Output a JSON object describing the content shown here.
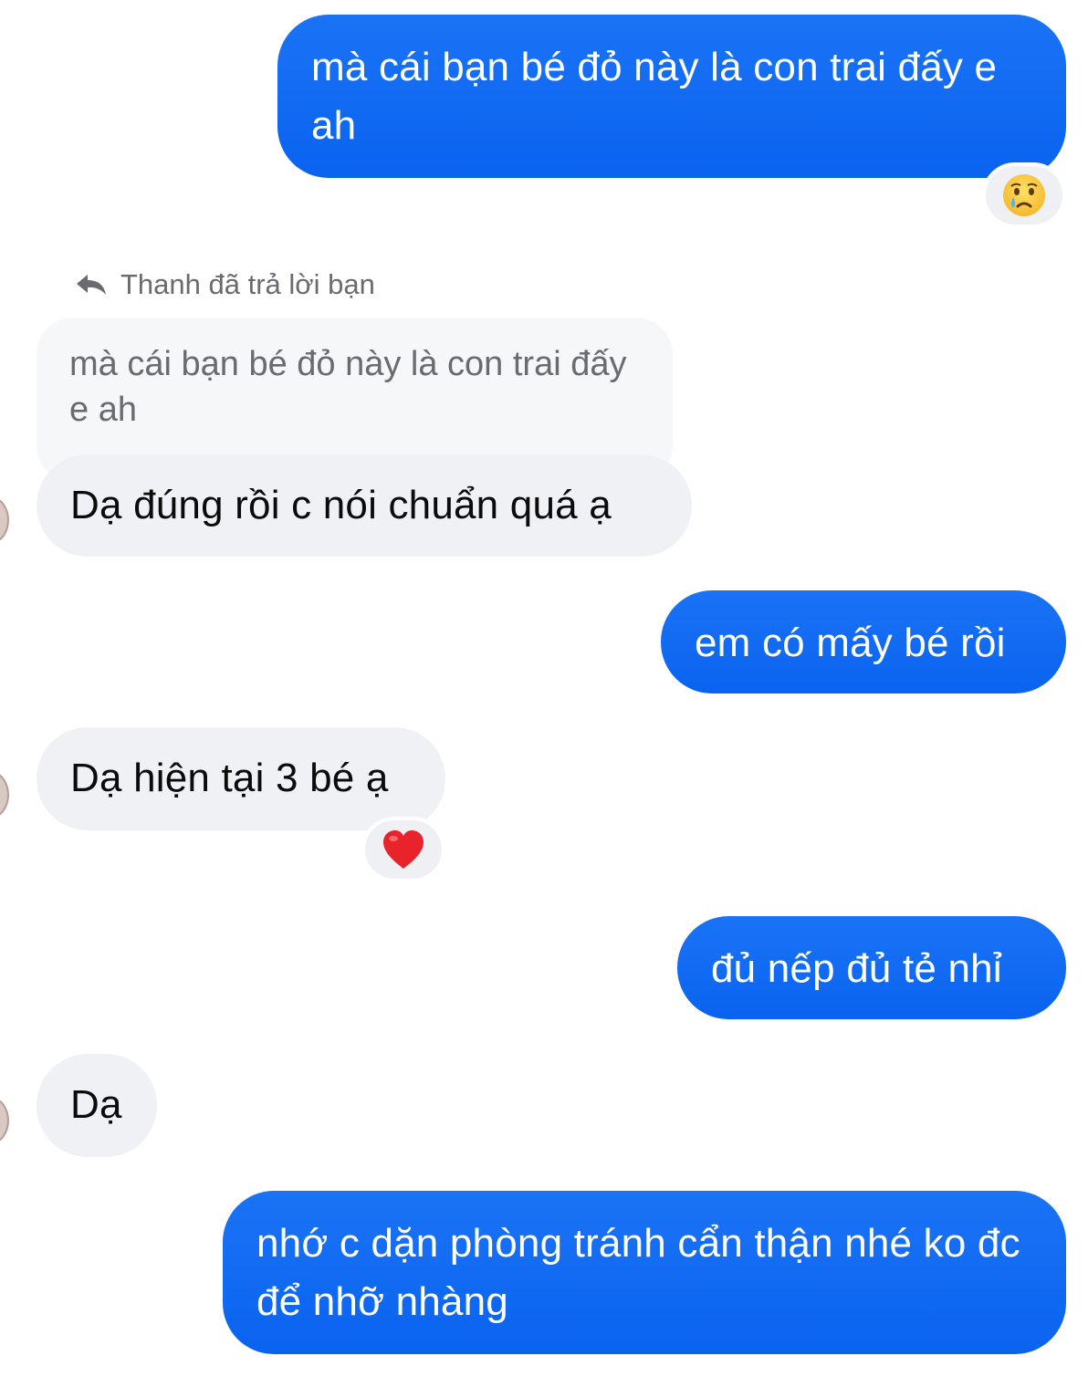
{
  "conversation": {
    "messages": [
      {
        "id": "m1",
        "direction": "outgoing",
        "text": "mà cái bạn bé đỏ này là con trai đấy e ah",
        "reaction": "crying-face"
      },
      {
        "id": "m2",
        "direction": "incoming",
        "reply_label": "Thanh đã trả lời bạn",
        "quoted_text": "mà cái bạn bé đỏ này là con trai đấy e ah",
        "text": "Dạ đúng rồi c nói chuẩn quá ạ"
      },
      {
        "id": "m3",
        "direction": "outgoing",
        "text": "em có mấy bé rồi"
      },
      {
        "id": "m4",
        "direction": "incoming",
        "text": "Dạ hiện tại 3 bé ạ",
        "reaction": "red-heart"
      },
      {
        "id": "m5",
        "direction": "outgoing",
        "text": "đủ nếp đủ tẻ nhỉ"
      },
      {
        "id": "m6",
        "direction": "incoming",
        "text": "Dạ"
      },
      {
        "id": "m7",
        "direction": "outgoing",
        "text": "nhớ c dặn phòng tránh cẩn thận nhé ko đc để nhỡ nhàng"
      }
    ]
  },
  "colors": {
    "outgoing_bubble": "#0a63ef",
    "incoming_bubble": "#f0f1f4",
    "quoted_bubble": "#f6f7f9",
    "secondary_text": "#6a6a6f"
  },
  "icons": {
    "reply": "reply-arrow-icon",
    "reaction_1": "crying-face-icon",
    "reaction_2": "red-heart-icon"
  }
}
